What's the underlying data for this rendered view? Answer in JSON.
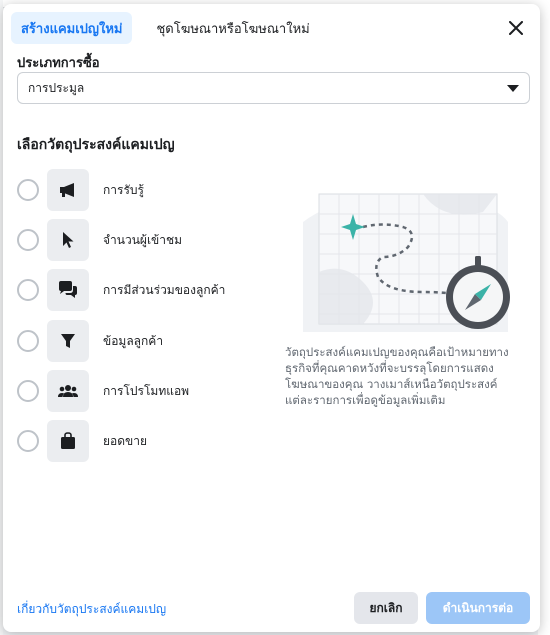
{
  "tabs": [
    {
      "label": "สร้างแคมเปญใหม่"
    },
    {
      "label": "ชุดโฆษณาหรือโฆษณาใหม่"
    }
  ],
  "buying_type": {
    "label": "ประเภทการซื้อ",
    "value": "การประมูล"
  },
  "objectives": {
    "title": "เลือกวัตถุประสงค์แคมเปญ",
    "items": [
      {
        "label": "การรับรู้",
        "icon": "megaphone-icon"
      },
      {
        "label": "จำนวนผู้เข้าชม",
        "icon": "cursor-icon"
      },
      {
        "label": "การมีส่วนร่วมของลูกค้า",
        "icon": "chat-bubbles-icon"
      },
      {
        "label": "ข้อมูลลูกค้า",
        "icon": "funnel-icon"
      },
      {
        "label": "การโปรโมทแอพ",
        "icon": "people-icon"
      },
      {
        "label": "ยอดขาย",
        "icon": "shopping-bag-icon"
      }
    ]
  },
  "description": "วัตถุประสงค์แคมเปญของคุณคือเป้าหมายทางธุรกิจที่คุณคาดหวังที่จะบรรลุโดยการแสดงโฆษณาของคุณ วางเมาส์เหนือวัตถุประสงค์แต่ละรายการเพื่อดูข้อมูลเพิ่มเติม",
  "footer": {
    "learn_link": "เกี่ยวกับวัตถุประสงค์แคมเปญ",
    "cancel": "ยกเลิก",
    "continue": "ดำเนินการต่อ"
  },
  "colors": {
    "accent": "#1877f2",
    "tab_active_bg": "#e7f3ff",
    "continue_disabled": "#9cc6f7",
    "illustration_teal": "#3bb3a8"
  }
}
